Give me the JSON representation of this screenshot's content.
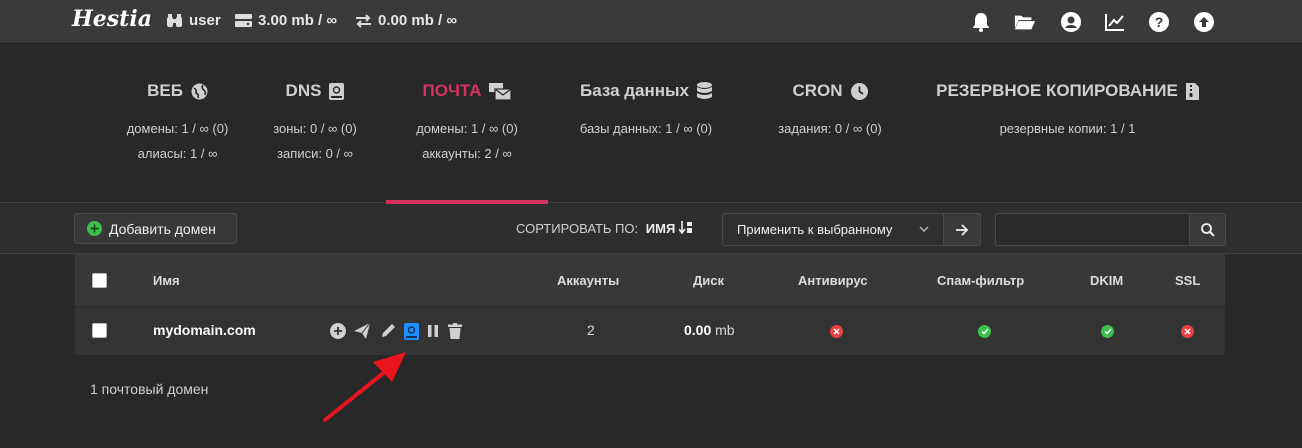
{
  "header": {
    "logo_text": "Hestia",
    "user": "user",
    "disk": "3.00 mb / ∞",
    "bandwidth": "0.00 mb / ∞",
    "icons": [
      "bell-icon",
      "folder-icon",
      "user-circle-icon",
      "chart-line-icon",
      "question-icon",
      "upload-icon"
    ]
  },
  "tabs": [
    {
      "title": "ВЕБ",
      "icon": "globe-icon",
      "lines": [
        "домены: 1 / ∞ (0)",
        "алиасы: 1 / ∞"
      ],
      "active": false
    },
    {
      "title": "DNS",
      "icon": "book-icon",
      "lines": [
        "зоны: 0 / ∞ (0)",
        "записи: 0 / ∞"
      ],
      "active": false
    },
    {
      "title": "ПОЧТА",
      "icon": "mail-bulk-icon",
      "lines": [
        "домены: 1 / ∞ (0)",
        "аккаунты: 2 / ∞"
      ],
      "active": true
    },
    {
      "title": "База данных",
      "icon": "database-icon",
      "lines": [
        "базы данных: 1 / ∞ (0)"
      ],
      "active": false
    },
    {
      "title": "CRON",
      "icon": "clock-icon",
      "lines": [
        "задания: 0 / ∞ (0)"
      ],
      "active": false
    },
    {
      "title": "РЕЗЕРВНОЕ КОПИРОВАНИЕ",
      "icon": "file-archive-icon",
      "lines": [
        "резервные копии: 1 / 1"
      ],
      "active": false
    }
  ],
  "toolbar": {
    "add_label": "Добавить домен",
    "sort_label": "СОРТИРОВАТЬ ПО:",
    "sort_value": "ИМЯ",
    "apply_label": "Применить к выбранному",
    "search_placeholder": ""
  },
  "table": {
    "headers": {
      "name": "Имя",
      "accounts": "Аккаунты",
      "disk": "Диск",
      "antivirus": "Антивирус",
      "spam": "Спам-фильтр",
      "dkim": "DKIM",
      "ssl": "SSL"
    },
    "rows": [
      {
        "name": "mydomain.com",
        "accounts": "2",
        "disk_value": "0.00",
        "disk_unit": "mb",
        "antivirus": "off",
        "spam": "on",
        "dkim": "on",
        "ssl": "off"
      }
    ]
  },
  "footer": {
    "count": "1 почтовый домен"
  },
  "colors": {
    "accent": "#d1325f",
    "on": "#3bbf4a",
    "off": "#e94141",
    "highlight": "#1e90ff",
    "annotation": "#e8141e"
  }
}
